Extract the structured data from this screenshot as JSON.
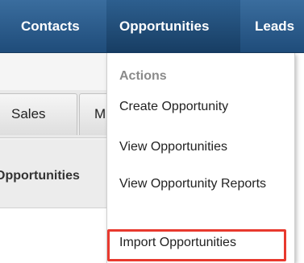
{
  "nav": {
    "contacts": "Contacts",
    "opportunities": "Opportunities",
    "leads": "Leads"
  },
  "page": {
    "tab_sales": "Sales",
    "tab_m": "M",
    "list_heading": "Opportunities"
  },
  "dropdown": {
    "heading": "Actions",
    "items": [
      "Create Opportunity",
      "View Opportunities",
      "View Opportunity Reports",
      "Import Opportunities"
    ]
  },
  "colors": {
    "nav_bar": "#1f4c7a",
    "highlight": "#e8392e",
    "heading_gray": "#8a8a8a"
  }
}
